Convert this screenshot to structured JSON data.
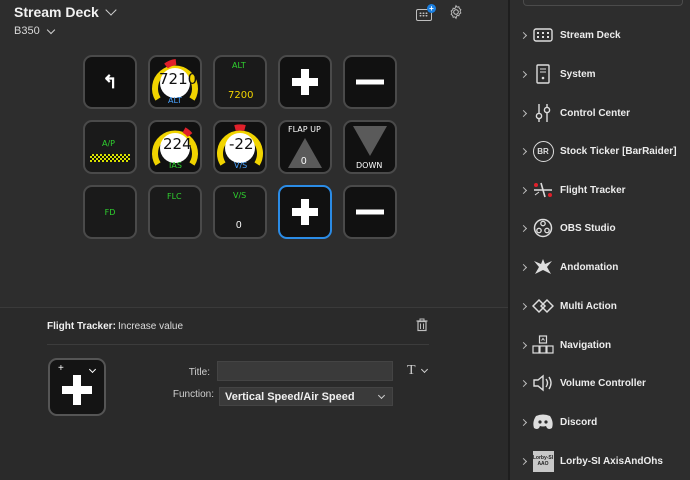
{
  "header": {
    "device_name": "Stream Deck",
    "profile_name": "B350",
    "add_badge": "+"
  },
  "keys": [
    {
      "name": "back",
      "arrow": "↰"
    },
    {
      "name": "alt-gauge",
      "value": "7210",
      "label": "ALT"
    },
    {
      "name": "alt-readout",
      "top": "ALT",
      "value": "7200"
    },
    {
      "name": "plus"
    },
    {
      "name": "minus"
    },
    {
      "name": "autopilot",
      "label": "A/P"
    },
    {
      "name": "ias-gauge",
      "value": "224",
      "label": "IAS"
    },
    {
      "name": "vs-gauge",
      "value": "-22",
      "label": "V/S"
    },
    {
      "name": "flap-up",
      "top": "FLAP UP",
      "value": "0"
    },
    {
      "name": "flap-down",
      "label": "DOWN"
    },
    {
      "name": "fd",
      "label": "FD"
    },
    {
      "name": "flc",
      "label": "FLC"
    },
    {
      "name": "vs-readout",
      "top": "V/S",
      "value": "0"
    },
    {
      "name": "plus-selected"
    },
    {
      "name": "minus-2"
    }
  ],
  "inspector": {
    "plugin": "Flight Tracker:",
    "action": "Increase value",
    "preview_mini": "+",
    "title_label": "Title:",
    "title_value": "",
    "function_label": "Function:",
    "function_value": "Vertical Speed/Air Speed",
    "title_font_glyph": "T"
  },
  "sidebar": {
    "items": [
      {
        "label": "Stream Deck",
        "icon": "stream-deck-icon"
      },
      {
        "label": "System",
        "icon": "system-icon"
      },
      {
        "label": "Control Center",
        "icon": "control-center-icon"
      },
      {
        "label": "Stock Ticker [BarRaider]",
        "icon": "stock-ticker-icon",
        "badge": "BR"
      },
      {
        "label": "Flight Tracker",
        "icon": "flight-tracker-icon"
      },
      {
        "label": "OBS Studio",
        "icon": "obs-studio-icon"
      },
      {
        "label": "Andomation",
        "icon": "andomation-icon"
      },
      {
        "label": "Multi Action",
        "icon": "multi-action-icon"
      },
      {
        "label": "Navigation",
        "icon": "navigation-icon"
      },
      {
        "label": "Volume Controller",
        "icon": "volume-controller-icon"
      },
      {
        "label": "Discord",
        "icon": "discord-icon"
      },
      {
        "label": "Lorby-SI AxisAndOhs",
        "icon": "lorby-icon",
        "badge_top": "Lorby-SI",
        "badge_bottom": "AAO"
      }
    ]
  },
  "colors": {
    "accent": "#2b8ce6",
    "gauge_yellow": "#f1d400",
    "gauge_red": "#e0202a",
    "text_green": "#2fd22f",
    "label_blue": "#4aa3ff"
  }
}
